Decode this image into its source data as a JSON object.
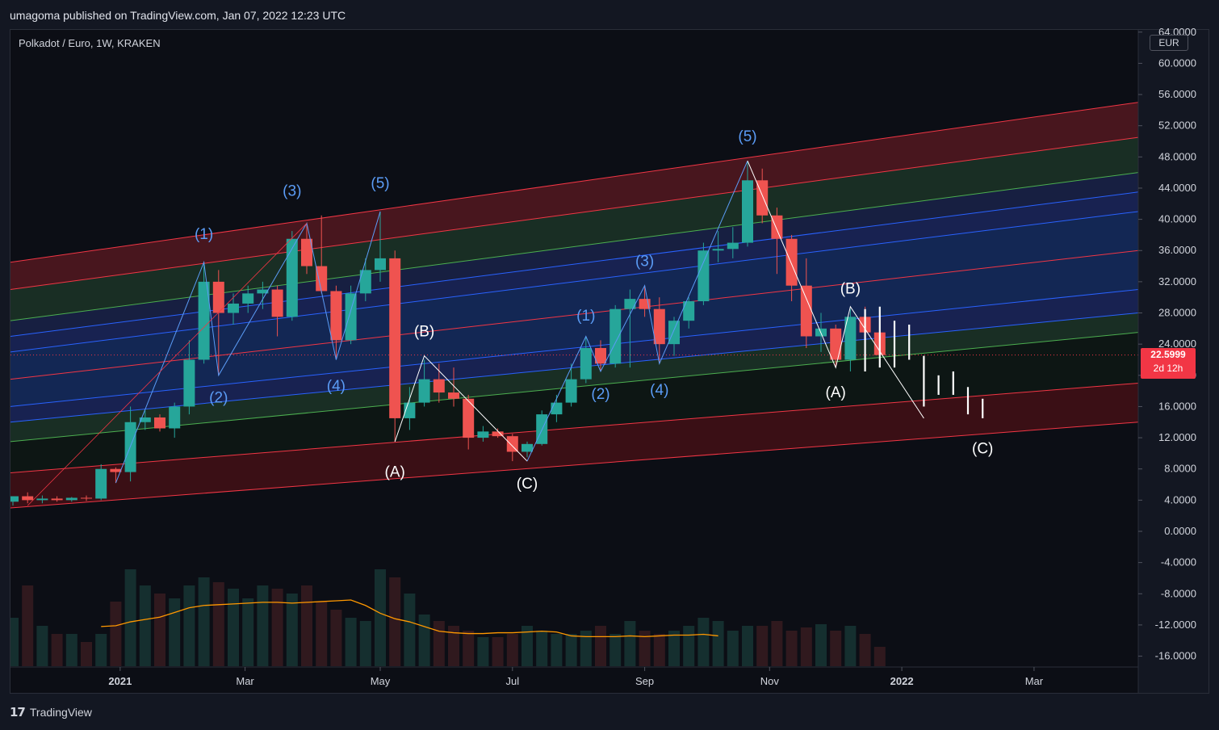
{
  "header": {
    "published": "umagoma published on TradingView.com, Jan 07, 2022 12:23 UTC"
  },
  "legend": {
    "symbol": "Polkadot / Euro, 1W, KRAKEN"
  },
  "price_scale": {
    "currency": "EUR",
    "ticks": [
      "64.0000",
      "60.0000",
      "56.0000",
      "52.0000",
      "48.0000",
      "44.0000",
      "40.0000",
      "36.0000",
      "32.0000",
      "28.0000",
      "24.0000",
      "20.0000",
      "16.0000",
      "12.0000",
      "8.0000",
      "4.0000",
      "0.0000",
      "-4.0000",
      "-8.0000",
      "-12.0000",
      "-16.0000"
    ],
    "last_price": "22.5999",
    "countdown": "2d 12h"
  },
  "time_scale": {
    "ticks": [
      "2021",
      "Mar",
      "May",
      "Jul",
      "Sep",
      "Nov",
      "2022",
      "Mar"
    ]
  },
  "footer": {
    "brand": "TradingView",
    "logo": "17"
  },
  "colors": {
    "up": "#26a69a",
    "down": "#ef5350",
    "background": "#0c0e15",
    "wave_blue": "#5b9cf6",
    "wave_white": "#ffffff",
    "channel_red": "#f23645",
    "ma_line": "#ff9800"
  },
  "annotations": {
    "impulse_labels": [
      "(1)",
      "(2)",
      "(3)",
      "(4)",
      "(5)",
      "(1)",
      "(2)",
      "(3)",
      "(4)",
      "(5)"
    ],
    "corrective_labels": [
      "(B)",
      "(A)",
      "(C)",
      "(B)",
      "(A)",
      "(C)"
    ]
  },
  "chart_data": {
    "type": "candlestick",
    "title": "Polkadot / Euro, 1W, KRAKEN",
    "ylim": [
      -18,
      64
    ],
    "last_price": 22.5999,
    "candles": [
      {
        "t": "2020-11-16",
        "o": 3.8,
        "h": 4.5,
        "l": 3.3,
        "c": 4.5
      },
      {
        "t": "2020-11-23",
        "o": 4.5,
        "h": 5.0,
        "l": 3.6,
        "c": 4.0
      },
      {
        "t": "2020-11-30",
        "o": 4.0,
        "h": 4.6,
        "l": 3.6,
        "c": 4.2
      },
      {
        "t": "2020-12-07",
        "o": 4.2,
        "h": 4.5,
        "l": 3.8,
        "c": 4.0
      },
      {
        "t": "2020-12-14",
        "o": 4.0,
        "h": 4.4,
        "l": 3.8,
        "c": 4.3
      },
      {
        "t": "2020-12-21",
        "o": 4.3,
        "h": 4.6,
        "l": 3.9,
        "c": 4.2
      },
      {
        "t": "2020-12-28",
        "o": 4.2,
        "h": 8.6,
        "l": 4.0,
        "c": 8.0
      },
      {
        "t": "2021-01-04",
        "o": 8.0,
        "h": 8.2,
        "l": 6.2,
        "c": 7.6
      },
      {
        "t": "2021-01-11",
        "o": 7.6,
        "h": 16.0,
        "l": 6.4,
        "c": 14.0
      },
      {
        "t": "2021-01-18",
        "o": 14.0,
        "h": 15.5,
        "l": 13.0,
        "c": 14.6
      },
      {
        "t": "2021-01-25",
        "o": 14.6,
        "h": 15.0,
        "l": 12.8,
        "c": 13.2
      },
      {
        "t": "2021-02-01",
        "o": 13.2,
        "h": 16.5,
        "l": 12.0,
        "c": 16.0
      },
      {
        "t": "2021-02-08",
        "o": 16.0,
        "h": 24.5,
        "l": 15.0,
        "c": 22.0
      },
      {
        "t": "2021-02-15",
        "o": 22.0,
        "h": 34.5,
        "l": 21.5,
        "c": 32.0
      },
      {
        "t": "2021-02-22",
        "o": 32.0,
        "h": 33.5,
        "l": 20.0,
        "c": 28.0
      },
      {
        "t": "2021-03-01",
        "o": 28.0,
        "h": 30.5,
        "l": 26.5,
        "c": 29.2
      },
      {
        "t": "2021-03-08",
        "o": 29.2,
        "h": 31.5,
        "l": 28.0,
        "c": 30.5
      },
      {
        "t": "2021-03-15",
        "o": 30.5,
        "h": 32.0,
        "l": 28.5,
        "c": 31.0
      },
      {
        "t": "2021-03-22",
        "o": 31.0,
        "h": 31.5,
        "l": 25.0,
        "c": 27.5
      },
      {
        "t": "2021-03-29",
        "o": 27.5,
        "h": 38.5,
        "l": 27.0,
        "c": 37.5
      },
      {
        "t": "2021-04-05",
        "o": 37.5,
        "h": 39.5,
        "l": 33.0,
        "c": 34.0
      },
      {
        "t": "2021-04-12",
        "o": 34.0,
        "h": 40.5,
        "l": 30.5,
        "c": 30.8
      },
      {
        "t": "2021-04-19",
        "o": 30.8,
        "h": 31.5,
        "l": 22.0,
        "c": 24.5
      },
      {
        "t": "2021-04-26",
        "o": 24.5,
        "h": 31.5,
        "l": 24.0,
        "c": 30.5
      },
      {
        "t": "2021-05-03",
        "o": 30.5,
        "h": 35.0,
        "l": 29.5,
        "c": 33.5
      },
      {
        "t": "2021-05-10",
        "o": 33.5,
        "h": 41.0,
        "l": 32.0,
        "c": 35.0
      },
      {
        "t": "2021-05-17",
        "o": 35.0,
        "h": 36.0,
        "l": 11.5,
        "c": 14.5
      },
      {
        "t": "2021-05-24",
        "o": 14.5,
        "h": 18.5,
        "l": 13.0,
        "c": 16.5
      },
      {
        "t": "2021-05-31",
        "o": 16.5,
        "h": 22.0,
        "l": 16.0,
        "c": 19.5
      },
      {
        "t": "2021-06-07",
        "o": 19.5,
        "h": 21.5,
        "l": 16.5,
        "c": 17.8
      },
      {
        "t": "2021-06-14",
        "o": 17.8,
        "h": 21.0,
        "l": 16.0,
        "c": 17.0
      },
      {
        "t": "2021-06-21",
        "o": 17.0,
        "h": 17.5,
        "l": 10.5,
        "c": 12.0
      },
      {
        "t": "2021-06-28",
        "o": 12.0,
        "h": 13.5,
        "l": 11.5,
        "c": 12.8
      },
      {
        "t": "2021-07-05",
        "o": 12.8,
        "h": 13.2,
        "l": 12.0,
        "c": 12.2
      },
      {
        "t": "2021-07-12",
        "o": 12.2,
        "h": 12.5,
        "l": 9.0,
        "c": 10.2
      },
      {
        "t": "2021-07-19",
        "o": 10.2,
        "h": 11.5,
        "l": 9.5,
        "c": 11.2
      },
      {
        "t": "2021-07-26",
        "o": 11.2,
        "h": 15.5,
        "l": 11.0,
        "c": 15.0
      },
      {
        "t": "2021-08-02",
        "o": 15.0,
        "h": 17.5,
        "l": 14.0,
        "c": 16.5
      },
      {
        "t": "2021-08-09",
        "o": 16.5,
        "h": 21.5,
        "l": 16.0,
        "c": 19.5
      },
      {
        "t": "2021-08-16",
        "o": 19.5,
        "h": 25.0,
        "l": 19.0,
        "c": 23.5
      },
      {
        "t": "2021-08-23",
        "o": 23.5,
        "h": 24.5,
        "l": 20.5,
        "c": 21.5
      },
      {
        "t": "2021-08-30",
        "o": 21.5,
        "h": 29.0,
        "l": 21.0,
        "c": 28.5
      },
      {
        "t": "2021-09-06",
        "o": 28.5,
        "h": 31.0,
        "l": 21.0,
        "c": 29.8
      },
      {
        "t": "2021-09-13",
        "o": 29.8,
        "h": 31.5,
        "l": 27.5,
        "c": 28.5
      },
      {
        "t": "2021-09-20",
        "o": 28.5,
        "h": 30.0,
        "l": 21.5,
        "c": 24.0
      },
      {
        "t": "2021-09-27",
        "o": 24.0,
        "h": 27.5,
        "l": 22.5,
        "c": 27.0
      },
      {
        "t": "2021-10-04",
        "o": 27.0,
        "h": 30.0,
        "l": 26.0,
        "c": 29.5
      },
      {
        "t": "2021-10-11",
        "o": 29.5,
        "h": 37.0,
        "l": 29.0,
        "c": 36.0
      },
      {
        "t": "2021-10-18",
        "o": 36.0,
        "h": 38.5,
        "l": 34.5,
        "c": 36.2
      },
      {
        "t": "2021-10-25",
        "o": 36.2,
        "h": 39.0,
        "l": 35.0,
        "c": 37.0
      },
      {
        "t": "2021-11-01",
        "o": 37.0,
        "h": 47.5,
        "l": 36.5,
        "c": 45.0
      },
      {
        "t": "2021-11-08",
        "o": 45.0,
        "h": 46.5,
        "l": 39.5,
        "c": 40.5
      },
      {
        "t": "2021-11-15",
        "o": 40.5,
        "h": 41.5,
        "l": 33.0,
        "c": 37.5
      },
      {
        "t": "2021-11-22",
        "o": 37.5,
        "h": 38.0,
        "l": 29.5,
        "c": 31.5
      },
      {
        "t": "2021-11-29",
        "o": 31.5,
        "h": 35.0,
        "l": 23.5,
        "c": 25.0
      },
      {
        "t": "2021-12-06",
        "o": 25.0,
        "h": 28.0,
        "l": 23.0,
        "c": 26.0
      },
      {
        "t": "2021-12-13",
        "o": 26.0,
        "h": 26.5,
        "l": 21.0,
        "c": 22.0
      },
      {
        "t": "2021-12-20",
        "o": 22.0,
        "h": 28.5,
        "l": 20.5,
        "c": 27.5
      },
      {
        "t": "2021-12-27",
        "o": 27.5,
        "h": 28.8,
        "l": 21.0,
        "c": 25.5
      },
      {
        "t": "2022-01-03",
        "o": 25.5,
        "h": 26.5,
        "l": 21.5,
        "c": 22.6
      }
    ],
    "volume": [
      0.3,
      0.5,
      0.25,
      0.2,
      0.2,
      0.15,
      0.2,
      0.4,
      0.6,
      0.5,
      0.45,
      0.42,
      0.5,
      0.55,
      0.52,
      0.48,
      0.42,
      0.5,
      0.48,
      0.45,
      0.5,
      0.4,
      0.35,
      0.3,
      0.28,
      0.6,
      0.55,
      0.45,
      0.32,
      0.28,
      0.25,
      0.22,
      0.18,
      0.18,
      0.2,
      0.25,
      0.22,
      0.2,
      0.2,
      0.22,
      0.25,
      0.2,
      0.28,
      0.22,
      0.2,
      0.22,
      0.25,
      0.3,
      0.28,
      0.22,
      0.25,
      0.25,
      0.28,
      0.22,
      0.24,
      0.26,
      0.22,
      0.25,
      0.2,
      0.12
    ],
    "moving_average": [
      -12.2,
      -12.1,
      -11.6,
      -11.3,
      -11.0,
      -10.4,
      -9.8,
      -9.5,
      -9.4,
      -9.3,
      -9.2,
      -9.1,
      -9.1,
      -9.2,
      -9.1,
      -9.0,
      -8.9,
      -8.8,
      -9.5,
      -10.5,
      -11.2,
      -11.6,
      -12.2,
      -12.8,
      -13.0,
      -13.1,
      -13.1,
      -13.0,
      -13.0,
      -12.9,
      -12.8,
      -12.9,
      -13.4,
      -13.5,
      -13.5,
      -13.5,
      -13.4,
      -13.5,
      -13.4,
      -13.3,
      -13.3,
      -13.2,
      -13.4
    ],
    "channel_lines": [
      {
        "color": "#f23645",
        "y_start": 34.5,
        "y_end": 55.0
      },
      {
        "color": "#f23645",
        "y_start": 31.0,
        "y_end": 50.5
      },
      {
        "color": "#4caf50",
        "y_start": 27.0,
        "y_end": 46.0
      },
      {
        "color": "#2962ff",
        "y_start": 25.0,
        "y_end": 43.5
      },
      {
        "color": "#2962ff",
        "y_start": 23.0,
        "y_end": 41.0
      },
      {
        "color": "#f23645",
        "y_start": 19.5,
        "y_end": 36.0
      },
      {
        "color": "#2962ff",
        "y_start": 16.0,
        "y_end": 31.0
      },
      {
        "color": "#2962ff",
        "y_start": 14.0,
        "y_end": 28.0
      },
      {
        "color": "#4caf50",
        "y_start": 11.5,
        "y_end": 25.5
      },
      {
        "color": "#f23645",
        "y_start": 7.5,
        "y_end": 19.0
      },
      {
        "color": "#f23645",
        "y_start": 3.0,
        "y_end": 14.0
      }
    ],
    "projection": [
      22.5,
      17.5,
      15.0,
      14.5
    ]
  }
}
